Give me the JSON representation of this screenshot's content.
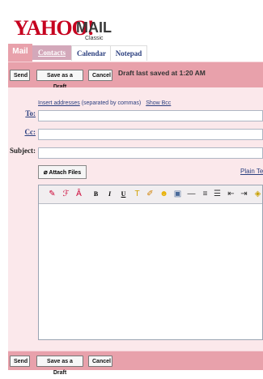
{
  "logo": {
    "brand": "YAHOO!",
    "product": "MAIL",
    "edition": "Classic"
  },
  "tabs": [
    {
      "label": "Mail"
    },
    {
      "label": "Contacts"
    },
    {
      "label": "Calendar"
    },
    {
      "label": "Notepad"
    }
  ],
  "toolbar": {
    "send": "Send",
    "save_draft": "Save as a Draft",
    "cancel": "Cancel",
    "status": "Draft last saved at 1:20 AM"
  },
  "compose": {
    "insert_addresses": "Insert addresses",
    "separated_note": "(separated by commas)",
    "show_bcc": "Show Bcc",
    "to_label": "To:",
    "cc_label": "Cc:",
    "subject_label": "Subject:",
    "to_value": "",
    "cc_value": "",
    "subject_value": "",
    "attach_files": "Attach Files",
    "plain_text": "Plain Tex"
  },
  "editor_tools": [
    {
      "icon": "spellcheck-icon",
      "glyph": "✎",
      "color": "#c03"
    },
    {
      "icon": "font-face-icon",
      "glyph": "ℱ",
      "color": "#c03"
    },
    {
      "icon": "font-size-icon",
      "glyph": "Â",
      "color": "#c03"
    },
    {
      "icon": "bold-icon",
      "glyph": "B",
      "color": "#000"
    },
    {
      "icon": "italic-icon",
      "glyph": "I",
      "color": "#000"
    },
    {
      "icon": "underline-icon",
      "glyph": "U",
      "color": "#000"
    },
    {
      "icon": "text-color-icon",
      "glyph": "T",
      "color": "#d0a000"
    },
    {
      "icon": "highlight-icon",
      "glyph": "✐",
      "color": "#d08000"
    },
    {
      "icon": "emoticon-icon",
      "glyph": "☻",
      "color": "#e8b000"
    },
    {
      "icon": "image-icon",
      "glyph": "▣",
      "color": "#4a6a9a"
    },
    {
      "icon": "horizontal-rule-icon",
      "glyph": "—",
      "color": "#333"
    },
    {
      "icon": "bullet-list-icon",
      "glyph": "≡",
      "color": "#333"
    },
    {
      "icon": "numbered-list-icon",
      "glyph": "☰",
      "color": "#333"
    },
    {
      "icon": "outdent-icon",
      "glyph": "⇤",
      "color": "#333"
    },
    {
      "icon": "indent-icon",
      "glyph": "⇥",
      "color": "#333"
    },
    {
      "icon": "stationery-icon",
      "glyph": "◈",
      "color": "#c8a000"
    }
  ],
  "colors": {
    "accent_pink": "#e8a1ab",
    "panel_pink": "#fbe8eb",
    "link_blue": "#2b3f7f",
    "brand_red": "#c6011f"
  }
}
